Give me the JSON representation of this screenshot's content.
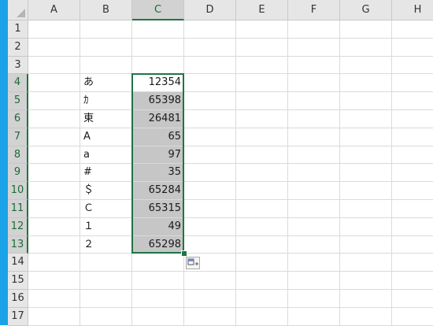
{
  "spreadsheet": {
    "columns": [
      "A",
      "B",
      "C",
      "D",
      "E",
      "F",
      "G",
      "H"
    ],
    "rows": [
      "1",
      "2",
      "3",
      "4",
      "5",
      "6",
      "7",
      "8",
      "9",
      "10",
      "11",
      "12",
      "13",
      "14",
      "15",
      "16",
      "17"
    ],
    "selected_column": "C",
    "selected_rows": [
      "4",
      "5",
      "6",
      "7",
      "8",
      "9",
      "10",
      "11",
      "12",
      "13"
    ],
    "data_rows": [
      {
        "row": "4",
        "b": "あ",
        "c": "12354"
      },
      {
        "row": "5",
        "b": "ｶ",
        "c": "65398"
      },
      {
        "row": "6",
        "b": "東",
        "c": "26481"
      },
      {
        "row": "7",
        "b": "A",
        "c": "65"
      },
      {
        "row": "8",
        "b": "a",
        "c": "97"
      },
      {
        "row": "9",
        "b": "#",
        "c": "35"
      },
      {
        "row": "10",
        "b": "＄",
        "c": "65284"
      },
      {
        "row": "11",
        "b": "Ｃ",
        "c": "65315"
      },
      {
        "row": "12",
        "b": "１",
        "c": "49"
      },
      {
        "row": "13",
        "b": "２",
        "c": "65298"
      }
    ],
    "quick_analysis_icon": "quick-analysis-icon",
    "colors": {
      "accent": "#217346",
      "selected_fill": "#c6c6c6",
      "window_strip": "#1aa3e8"
    }
  }
}
